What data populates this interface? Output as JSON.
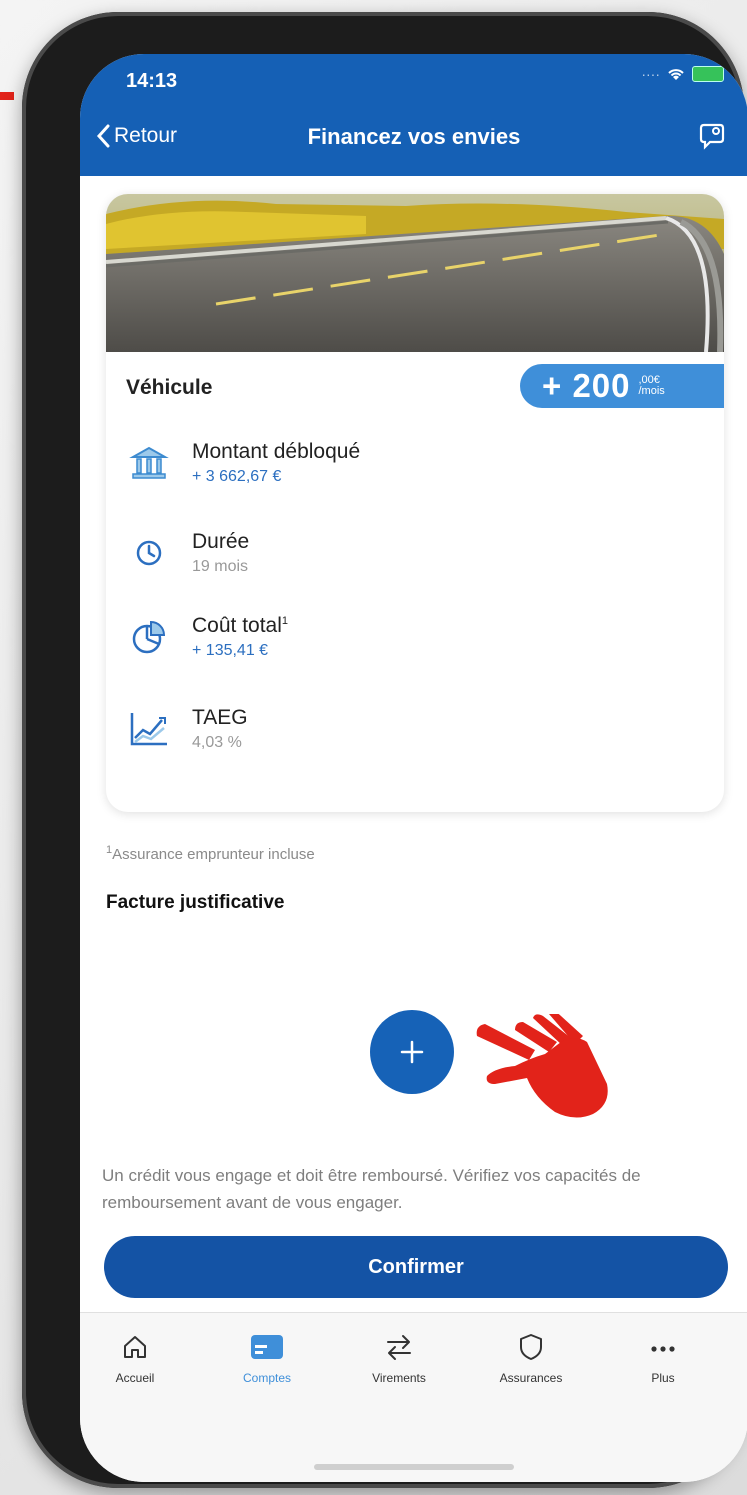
{
  "status_bar": {
    "time": "14:13"
  },
  "header": {
    "back_label": "Retour",
    "title": "Financez vos envies"
  },
  "card": {
    "title": "Véhicule",
    "badge": {
      "amount": "+ 200",
      "cents": ",00€",
      "unit": "/mois"
    },
    "details": [
      {
        "icon": "bank-icon",
        "label": "Montant débloqué",
        "value": "+ 3 662,67 €",
        "style": "blue"
      },
      {
        "icon": "clock-icon",
        "label": "Durée",
        "value": "19 mois",
        "style": "grey"
      },
      {
        "icon": "pie-chart-icon",
        "label": "Coût total",
        "sup": "1",
        "value": "+ 135,41 €",
        "style": "blue"
      },
      {
        "icon": "line-chart-icon",
        "label": "TAEG",
        "value": "4,03 %",
        "style": "grey"
      }
    ]
  },
  "note": {
    "sup": "1",
    "text": "Assurance emprunteur incluse"
  },
  "section_title": "Facture justificative",
  "disclaimer": "Un crédit vous engage et doit être remboursé. Vérifiez vos capacités de remboursement avant de vous engager.",
  "confirm_label": "Confirmer",
  "tabs": [
    {
      "label": "Accueil",
      "icon": "home-icon",
      "active": false
    },
    {
      "label": "Comptes",
      "icon": "card-icon",
      "active": true
    },
    {
      "label": "Virements",
      "icon": "transfer-icon",
      "active": false
    },
    {
      "label": "Assurances",
      "icon": "shield-icon",
      "active": false
    },
    {
      "label": "Plus",
      "icon": "more-icon",
      "active": false
    }
  ],
  "colors": {
    "header_blue": "#1560b5",
    "accent_blue": "#3f8fd9",
    "button_blue": "#1453a5",
    "hand_red": "#e2231a"
  }
}
